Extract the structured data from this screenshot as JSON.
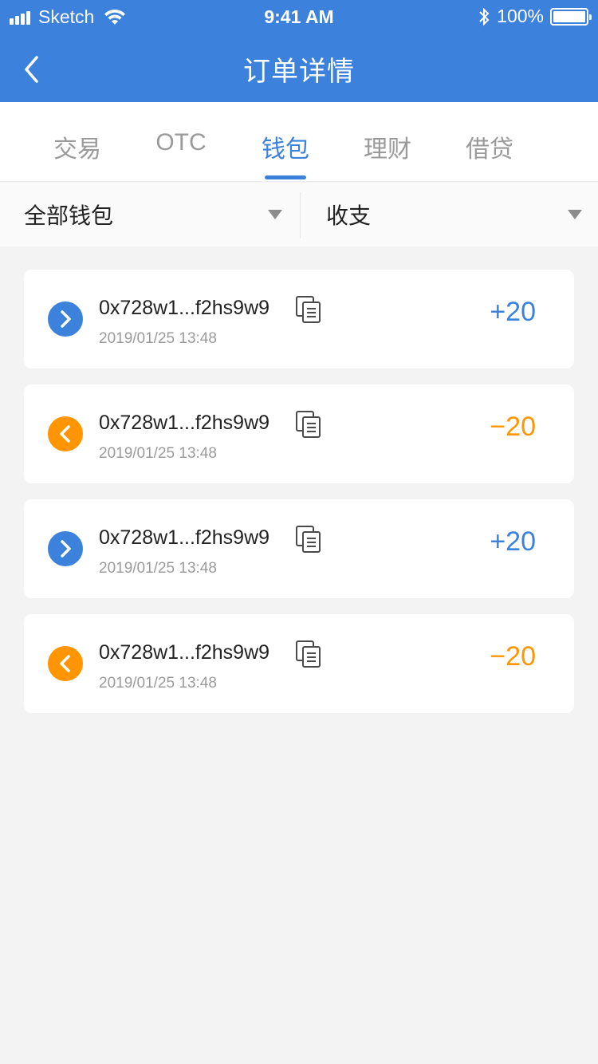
{
  "status_bar": {
    "carrier": "Sketch",
    "time": "9:41 AM",
    "battery": "100%"
  },
  "nav": {
    "title": "订单详情"
  },
  "tabs": [
    {
      "label": "交易"
    },
    {
      "label": "OTC"
    },
    {
      "label": "钱包"
    },
    {
      "label": "理财"
    },
    {
      "label": "借贷"
    }
  ],
  "active_tab": "钱包",
  "filters": {
    "wallet": "全部钱包",
    "type": "收支"
  },
  "colors": {
    "primary": "#3c82dd",
    "income": "#3c82dd",
    "expense": "#ff9500"
  },
  "transactions": [
    {
      "direction": "in",
      "address": "0x728w1...f2hs9w9",
      "time": "2019/01/25 13:48",
      "amount": "+20"
    },
    {
      "direction": "out",
      "address": "0x728w1...f2hs9w9",
      "time": "2019/01/25 13:48",
      "amount": "−20"
    },
    {
      "direction": "in",
      "address": "0x728w1...f2hs9w9",
      "time": "2019/01/25 13:48",
      "amount": "+20"
    },
    {
      "direction": "out",
      "address": "0x728w1...f2hs9w9",
      "time": "2019/01/25 13:48",
      "amount": "−20"
    }
  ]
}
